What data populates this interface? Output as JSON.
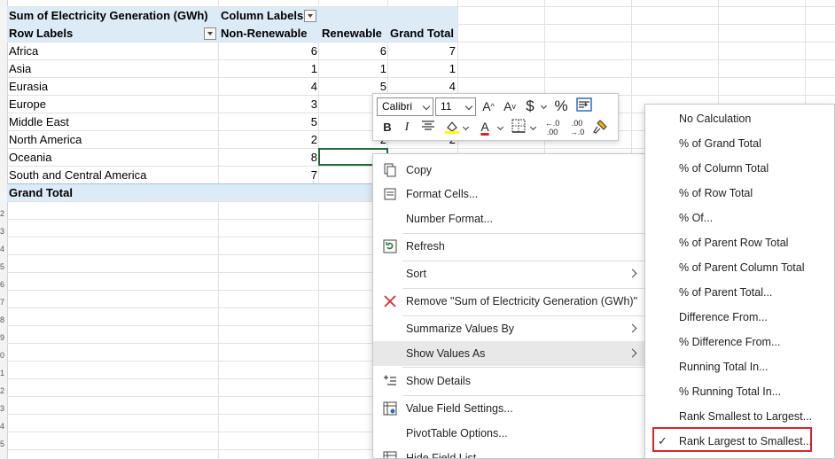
{
  "pivot": {
    "values_header": "Sum of Electricity Generation (GWh)",
    "column_labels": "Column Labels",
    "row_labels": "Row Labels",
    "columns": [
      "Non-Renewable",
      "Renewable",
      "Grand Total"
    ],
    "rows": [
      {
        "label": "Africa",
        "values": [
          "6",
          "6",
          "7"
        ]
      },
      {
        "label": "Asia",
        "values": [
          "1",
          "1",
          "1"
        ]
      },
      {
        "label": "Eurasia",
        "values": [
          "4",
          "5",
          "4"
        ]
      },
      {
        "label": "Europe",
        "values": [
          "3",
          "",
          ""
        ]
      },
      {
        "label": "Middle East",
        "values": [
          "5",
          "",
          ""
        ]
      },
      {
        "label": "North America",
        "values": [
          "2",
          "2",
          "2"
        ]
      },
      {
        "label": "Oceania",
        "values": [
          "8",
          "",
          ""
        ]
      },
      {
        "label": "South and Central America",
        "values": [
          "7",
          "",
          ""
        ]
      }
    ],
    "grand_total_label": "Grand Total"
  },
  "mini_toolbar": {
    "font_name": "Calibri",
    "font_size": "11",
    "grow_font": "A",
    "shrink_font": "A",
    "currency": "$",
    "percent": "%",
    "bold": "B",
    "italic": "I",
    "font_color_letter": "A",
    "font_color": "#d9242a",
    "highlight_color": "#ffff00",
    "inc_decimal": "←.0 .00",
    "dec_decimal": ".00 →.0"
  },
  "context_menu": {
    "items": [
      {
        "label": "Copy",
        "icon": "copy-icon"
      },
      {
        "label": "Format Cells...",
        "icon": "format-cells-icon"
      },
      {
        "label": "Number Format...",
        "icon": ""
      },
      {
        "label": "Refresh",
        "icon": "refresh-icon"
      },
      {
        "label": "Sort",
        "icon": ""
      },
      {
        "label": "Remove \"Sum of Electricity Generation (GWh)\"",
        "icon": "remove-x-icon"
      },
      {
        "label": "Summarize Values By",
        "icon": ""
      },
      {
        "label": "Show Values As",
        "icon": ""
      },
      {
        "label": "Show Details",
        "icon": "show-details-icon"
      },
      {
        "label": "Value Field Settings...",
        "icon": "value-field-settings-icon"
      },
      {
        "label": "PivotTable Options...",
        "icon": ""
      },
      {
        "label": "Hide Field List",
        "icon": "field-list-icon"
      }
    ]
  },
  "submenu": {
    "items": [
      {
        "label": "No Calculation"
      },
      {
        "label": "% of Grand Total"
      },
      {
        "label": "% of Column Total"
      },
      {
        "label": "% of Row Total"
      },
      {
        "label": "% Of..."
      },
      {
        "label": "% of Parent Row Total"
      },
      {
        "label": "% of Parent Column Total"
      },
      {
        "label": "% of Parent Total..."
      },
      {
        "label": "Difference From..."
      },
      {
        "label": "% Difference From..."
      },
      {
        "label": "Running Total In..."
      },
      {
        "label": "% Running Total In..."
      },
      {
        "label": "Rank Smallest to Largest..."
      },
      {
        "label": "Rank Largest to Smallest..."
      }
    ],
    "checkmark": "✓"
  },
  "row_numbers": [
    "2",
    "3",
    "4",
    "5",
    "6",
    "7",
    "8",
    "9",
    "0",
    "1",
    "2",
    "3",
    "4",
    "5",
    "6",
    "7",
    "8",
    "9",
    "0",
    "1",
    "2",
    "3",
    "4",
    "5",
    "6",
    "7"
  ]
}
